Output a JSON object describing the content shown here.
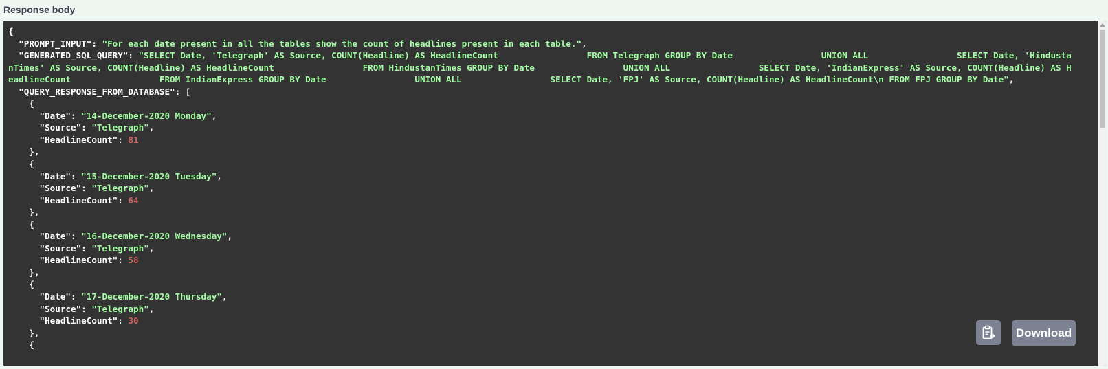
{
  "section_label": "Response body",
  "response": {
    "open_brace": "{",
    "prompt_key": "\"PROMPT_INPUT\"",
    "prompt_value": "\"For each date present in all the tables show the count of headlines present in each table.\"",
    "sql_key": "\"GENERATED_SQL_QUERY\"",
    "sql_value": "\"SELECT Date, 'Telegraph' AS Source, COUNT(Headline) AS HeadlineCount                 FROM Telegraph GROUP BY Date                 UNION ALL                 SELECT Date, 'HindustanTimes' AS Source, COUNT(Headline) AS HeadlineCount                 FROM HindustanTimes GROUP BY Date                 UNION ALL                 SELECT Date, 'IndianExpress' AS Source, COUNT(Headline) AS HeadlineCount                 FROM IndianExpress GROUP BY Date                 UNION ALL                 SELECT Date, 'FPJ' AS Source, COUNT(Headline) AS HeadlineCount\\n FROM FPJ GROUP BY Date\"",
    "db_key": "\"QUERY_RESPONSE_FROM_DATABASE\"",
    "date_key": "\"Date\"",
    "source_key": "\"Source\"",
    "count_key": "\"HeadlineCount\"",
    "records": [
      {
        "date": "\"14-December-2020 Monday\"",
        "source": "\"Telegraph\"",
        "count": "81"
      },
      {
        "date": "\"15-December-2020 Tuesday\"",
        "source": "\"Telegraph\"",
        "count": "64"
      },
      {
        "date": "\"16-December-2020 Wednesday\"",
        "source": "\"Telegraph\"",
        "count": "58"
      },
      {
        "date": "\"17-December-2020 Thursday\"",
        "source": "\"Telegraph\"",
        "count": "30"
      }
    ]
  },
  "buttons": {
    "download_label": "Download"
  },
  "icons": {
    "copy": "clipboard-copy-icon"
  }
}
